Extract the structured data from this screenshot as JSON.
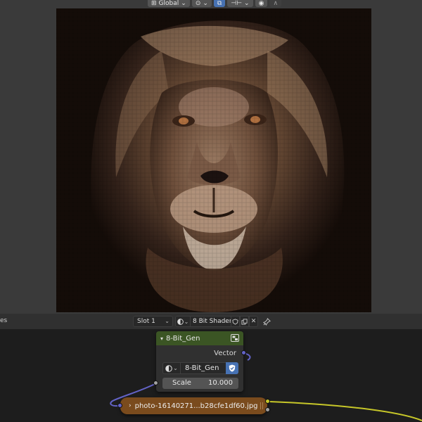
{
  "viewport": {
    "transform_orientation": "Global",
    "snap_icon": "snap-icon",
    "proportional_icon": "proportional-edit-icon"
  },
  "node_editor": {
    "left_label": "es",
    "slot": "Slot 1",
    "material_name": "8 Bit Shader",
    "icons": [
      "fake-user-icon",
      "duplicate-icon",
      "unlink-icon",
      "pin-icon"
    ]
  },
  "group_node": {
    "title": "8-Bit_Gen",
    "output_label": "Vector",
    "node_group_name": "8-Bit_Gen",
    "scale_label": "Scale",
    "scale_value": "10.000",
    "header_color": "#3b5524"
  },
  "image_node": {
    "label": "photo-16140271...b28cfe1df60.jpg",
    "color": "#7a4b1d"
  },
  "colors": {
    "accent": "#4772b3",
    "vector_socket": "#6363c7",
    "color_socket": "#c7c729"
  }
}
